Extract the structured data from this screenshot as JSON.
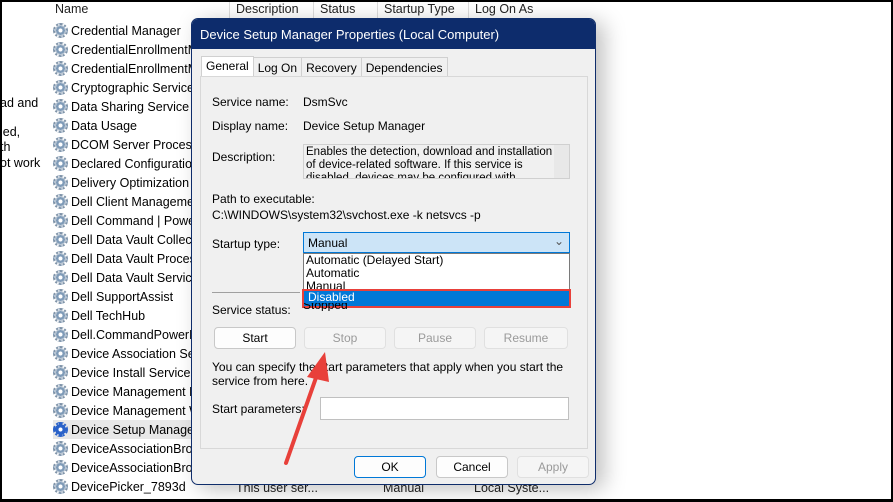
{
  "columns": [
    "Name",
    "Description",
    "Status",
    "Startup Type",
    "Log On As"
  ],
  "left_fragments": [
    "ad and",
    "led,",
    "th",
    "ot work"
  ],
  "services": [
    "Credential Manager",
    "CredentialEnrollmentManager",
    "CredentialEnrollmentManager",
    "Cryptographic Services",
    "Data Sharing Service",
    "Data Usage",
    "DCOM Server Process Launcher",
    "Declared Configuration",
    "Delivery Optimization",
    "Dell Client Management",
    "Dell Command | Power Manager",
    "Dell Data Vault Collector",
    "Dell Data Vault Processor",
    "Dell Data Vault Service",
    "Dell SupportAssist",
    "Dell TechHub",
    "Dell.CommandPowerManager",
    "Device Association Service",
    "Device Install Service",
    "Device Management Enrollment",
    "Device Management WAP",
    "Device Setup Manager",
    "DeviceAssociationBroker",
    "DeviceAssociationBroker",
    "DevicePicker_7893d"
  ],
  "last_row": {
    "description": "This user ser...",
    "startup": "Manual",
    "logon": "Local Syste..."
  },
  "dialog": {
    "title": "Device Setup Manager Properties (Local Computer)",
    "tabs": [
      "General",
      "Log On",
      "Recovery",
      "Dependencies"
    ],
    "service_name_label": "Service name:",
    "service_name": "DsmSvc",
    "display_name_label": "Display name:",
    "display_name": "Device Setup Manager",
    "description_label": "Description:",
    "description": "Enables the detection, download and installation of device-related software. If this service is disabled, devices may be configured with outdated software",
    "path_label": "Path to executable:",
    "path": "C:\\WINDOWS\\system32\\svchost.exe -k netsvcs -p",
    "startup_label": "Startup type:",
    "startup_value": "Manual",
    "startup_options": [
      "Automatic (Delayed Start)",
      "Automatic",
      "Manual",
      "Disabled"
    ],
    "status_label": "Service status:",
    "status_value": "Stopped",
    "buttons": {
      "start": "Start",
      "stop": "Stop",
      "pause": "Pause",
      "resume": "Resume"
    },
    "hint": "You can specify the start parameters that apply when you start the service from here.",
    "params_label": "Start parameters:",
    "params_value": "",
    "ok": "OK",
    "cancel": "Cancel",
    "apply": "Apply"
  },
  "colors": {
    "titlebar": "#0d2c6c",
    "highlight": "#0078d7",
    "annotation": "#e8403a"
  }
}
